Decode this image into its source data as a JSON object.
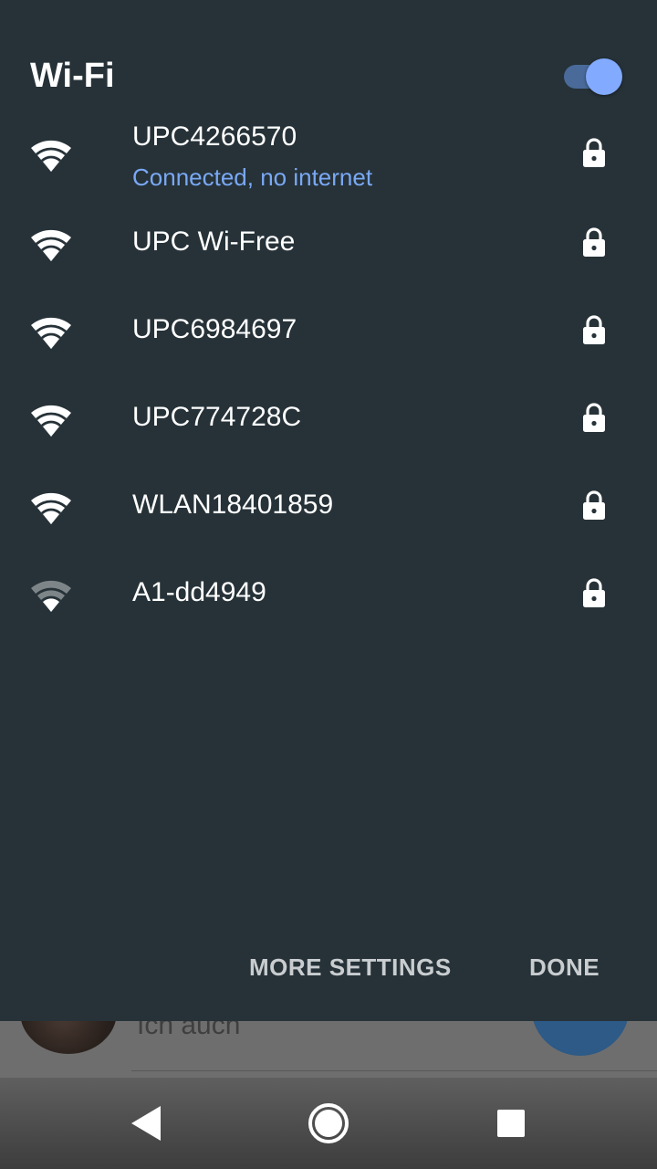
{
  "colors": {
    "panel_bg": "#263238",
    "accent": "#7aa8f5",
    "toggle_track": "#4a6a9a",
    "toggle_thumb": "#82aaff",
    "text_primary": "#ffffff",
    "action_text": "#c9cdd0"
  },
  "panel": {
    "title": "Wi-Fi",
    "toggle_state": "on"
  },
  "networks": [
    {
      "name": "UPC4266570",
      "status": "Connected, no internet",
      "signal_icon": "wifi-full-icon",
      "secured": true,
      "lock_icon": "lock-icon"
    },
    {
      "name": "UPC Wi-Free",
      "signal_icon": "wifi-full-icon",
      "secured": true,
      "lock_icon": "lock-icon"
    },
    {
      "name": "UPC6984697",
      "signal_icon": "wifi-full-icon",
      "secured": true,
      "lock_icon": "lock-icon"
    },
    {
      "name": "UPC774728C",
      "signal_icon": "wifi-full-icon",
      "secured": true,
      "lock_icon": "lock-icon"
    },
    {
      "name": "WLAN18401859",
      "signal_icon": "wifi-full-icon",
      "secured": true,
      "lock_icon": "lock-icon"
    },
    {
      "name": "A1-dd4949",
      "signal_icon": "wifi-weak-icon",
      "secured": true,
      "lock_icon": "lock-icon"
    }
  ],
  "actions": {
    "more_settings": "MORE SETTINGS",
    "done": "DONE"
  },
  "background": {
    "message": "Ich auch"
  },
  "nav": {
    "back_icon": "back-icon",
    "home_icon": "home-icon",
    "recents_icon": "recents-icon"
  }
}
